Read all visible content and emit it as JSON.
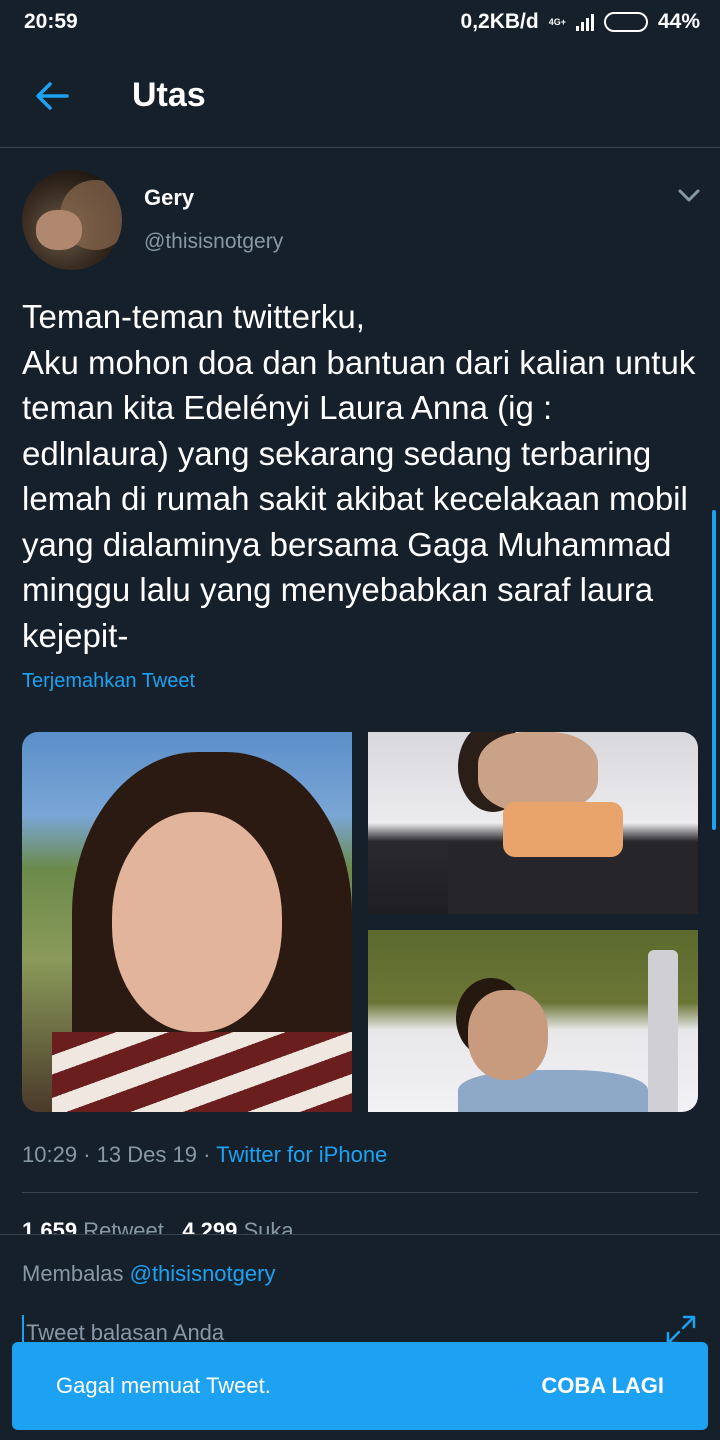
{
  "status_bar": {
    "time": "20:59",
    "network_speed": "0,2KB/d",
    "network_type": "4G+",
    "battery": "44%",
    "battery_level": 0.44,
    "battery_color": "#f5a623"
  },
  "header": {
    "title": "Utas",
    "back_icon": "arrow-left-icon"
  },
  "tweet": {
    "display_name": "Gery",
    "handle": "@thisisnotgery",
    "text": "Teman-teman twitterku,\nAku mohon doa dan bantuan dari kalian untuk teman kita Edelényi Laura Anna (ig : edlnlaura) yang sekarang sedang terbaring lemah di rumah sakit akibat kecelakaan mobil yang dialaminya bersama Gaga Muhammad minggu lalu yang menyebabkan saraf laura kejepit-",
    "translate_label": "Terjemahkan Tweet",
    "time": "10:29",
    "date": "13 Des 19",
    "source": "Twitter for iPhone",
    "retweet_count": "1.659",
    "retweet_label": "Retweet",
    "like_count": "4.299",
    "like_label": "Suka"
  },
  "reply": {
    "replying_label": "Membalas",
    "replying_to": "@thisisnotgery",
    "placeholder": "Tweet balasan Anda"
  },
  "snackbar": {
    "message": "Gagal memuat Tweet.",
    "action": "COBA LAGI"
  },
  "colors": {
    "background": "#15202b",
    "accent": "#1da1f2",
    "muted": "#8899a6",
    "divider": "#38444d"
  }
}
